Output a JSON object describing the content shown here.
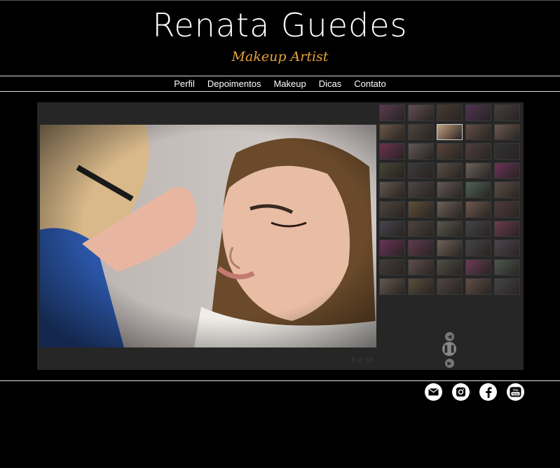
{
  "header": {
    "title": "Renata Guedes",
    "subtitle": "Makeup Artist"
  },
  "nav": {
    "items": [
      "Perfil",
      "Depoimentos",
      "Makeup",
      "Dicas",
      "Contato"
    ]
  },
  "gallery": {
    "counter": "8 of 50",
    "controls": {
      "prev": "previous-icon",
      "pause": "pause-icon",
      "next": "next-icon"
    },
    "thumbnail_colors": [
      "#7a4b6a",
      "#8a6a72",
      "#5c4a3a",
      "#6a3f6e",
      "#5a5050",
      "#9a7a5a",
      "#6a5a4a",
      "#c0a080",
      "#8a6a5a",
      "#9a7a6a",
      "#9a3a6a",
      "#8a7a7a",
      "#7a5a4a",
      "#6a5050",
      "#3a3a3a",
      "#5a5a3a",
      "#4a4a4a",
      "#7a6a5a",
      "#9a8a7a",
      "#9a3a7a",
      "#8a7a6a",
      "#6a5a5a",
      "#8a7a7a",
      "#6a8a7a",
      "#7a6a5a",
      "#6a5a4a",
      "#8a6a4a",
      "#9a8a7a",
      "#a07a6a",
      "#6a4a4a",
      "#5a5a6a",
      "#6a5a4a",
      "#7a7a6a",
      "#5a5a5a",
      "#9a4a6a",
      "#9a3a7a",
      "#8a4a6a",
      "#a08a7a",
      "#5a5a5a",
      "#6a5a6a",
      "#5a4a4a",
      "#8a6a6a",
      "#6a6a5a",
      "#9a4a7a",
      "#6a7a6a",
      "#8a7a6a",
      "#7a6a4a",
      "#6a5a5a",
      "#8a6a5a",
      "#5a5a5a"
    ],
    "active_thumbnail": 7
  },
  "social": {
    "icons": [
      "mail-icon",
      "instagram-icon",
      "facebook-icon",
      "youtube-icon"
    ]
  }
}
